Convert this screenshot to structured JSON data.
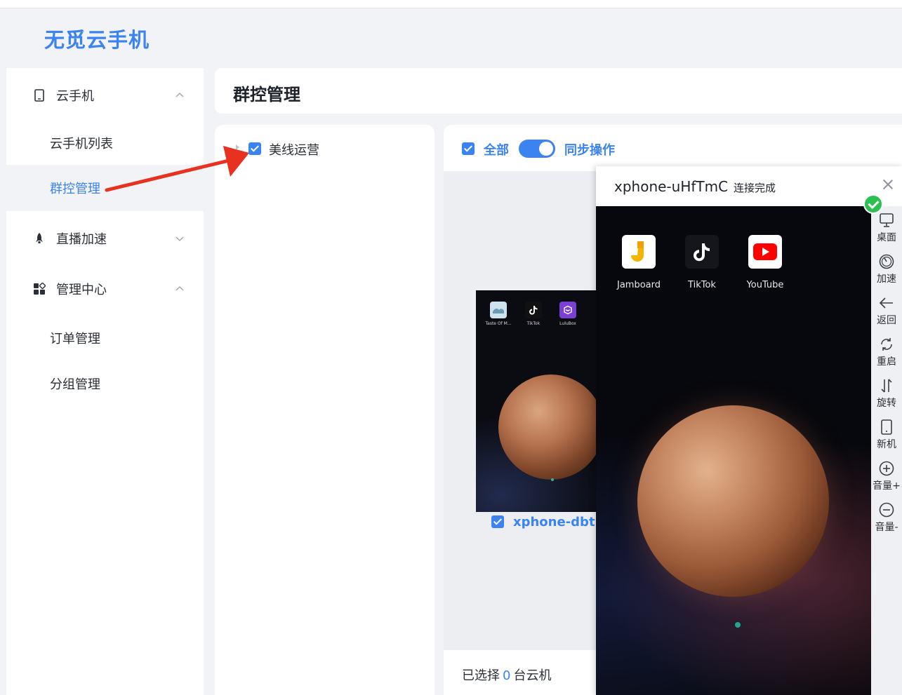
{
  "app": {
    "logo_text": "无觅云手机"
  },
  "sidebar": {
    "groups": [
      {
        "label": "云手机",
        "icon": "phone-icon",
        "expanded": true,
        "items": [
          {
            "label": "云手机列表",
            "active": false
          },
          {
            "label": "群控管理",
            "active": true
          }
        ]
      },
      {
        "label": "直播加速",
        "icon": "rocket-icon",
        "expanded": false,
        "items": []
      },
      {
        "label": "管理中心",
        "icon": "dashboard-icon",
        "expanded": true,
        "items": [
          {
            "label": "订单管理",
            "active": false
          },
          {
            "label": "分组管理",
            "active": false
          }
        ]
      }
    ]
  },
  "page": {
    "title": "群控管理"
  },
  "group_panel": {
    "group_label": "美线运营",
    "checked": true
  },
  "main": {
    "all_label": "全部",
    "all_checked": true,
    "sync_toggle_on": true,
    "sync_label": "同步操作",
    "device_card": {
      "name": "xphone-dbtkY",
      "checked": true,
      "apps": [
        "Taste Of M...",
        "TikTok",
        "LuluBox"
      ]
    },
    "footer": {
      "prefix": "已选择",
      "count": "0",
      "suffix": "台云机"
    }
  },
  "popup": {
    "title": "xphone-uHfTmC",
    "status": "连接完成",
    "apps": [
      {
        "label": "Jamboard"
      },
      {
        "label": "TikTok"
      },
      {
        "label": "YouTube"
      }
    ],
    "toolbar": [
      {
        "label": "桌面",
        "icon": "desktop-icon"
      },
      {
        "label": "加速",
        "icon": "speed-icon"
      },
      {
        "label": "返回",
        "icon": "back-arrow-icon"
      },
      {
        "label": "重启",
        "icon": "restart-icon"
      },
      {
        "label": "旋转",
        "icon": "rotate-icon"
      },
      {
        "label": "新机",
        "icon": "new-phone-icon"
      },
      {
        "label": "音量+",
        "icon": "volume-up-icon"
      },
      {
        "label": "音量-",
        "icon": "volume-down-icon"
      }
    ]
  },
  "colors": {
    "accent": "#3b83f0",
    "annotation_arrow": "#e8321f",
    "connected": "#2bc04f"
  }
}
